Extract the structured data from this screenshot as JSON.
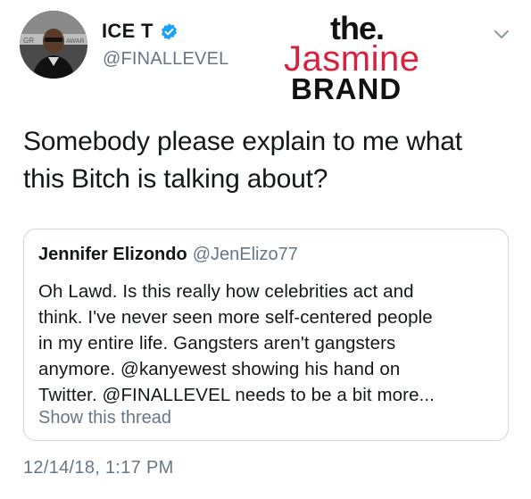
{
  "author": {
    "display_name": "ICE T",
    "handle": "@FINALLEVEL",
    "verified": true,
    "avatar_banner_text": "GR AWARD"
  },
  "watermark": {
    "line1": "the.",
    "line2": "Jasmine",
    "line3": "BRAND",
    "accent_color": "#d8203f"
  },
  "tweet": {
    "text_line1": "Somebody please explain to me what",
    "text_line2": "this Bitch is talking about?",
    "timestamp": "12/14/18, 1:17 PM"
  },
  "quoted_tweet": {
    "display_name": "Jennifer Elizondo",
    "handle": "@JenElizo77",
    "lines": [
      "Oh Lawd. Is this really how celebrities act and",
      "think. I've never seen more self-centered people",
      "in my entire life. Gangsters aren't gangsters",
      "anymore. @kanyewest showing his hand on",
      "Twitter. @FINALLEVEL needs to be a bit more..."
    ],
    "show_thread_label": "Show this thread"
  },
  "colors": {
    "verified_blue": "#1da1f2",
    "secondary_text": "#657786",
    "border": "#ccd6dd"
  },
  "icons": {
    "verified": "verified-badge-icon",
    "menu": "chevron-down-icon"
  }
}
